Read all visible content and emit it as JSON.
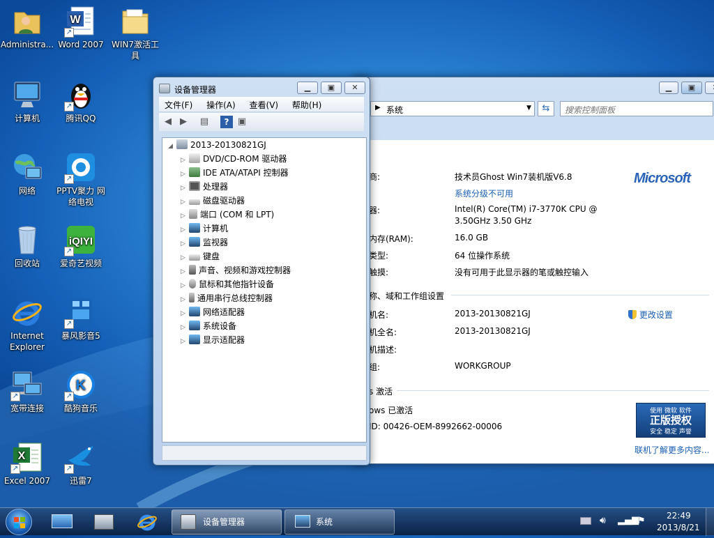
{
  "desktop": {
    "icons": [
      {
        "label": "Administra..."
      },
      {
        "label": "Word 2007"
      },
      {
        "label": "WIN7激活工具"
      },
      {
        "label": "计算机"
      },
      {
        "label": "腾讯QQ"
      },
      {
        "label": "网络"
      },
      {
        "label": "PPTV聚力 网络电视"
      },
      {
        "label": "回收站"
      },
      {
        "label": "爱奇艺视频"
      },
      {
        "label": "Internet Explorer"
      },
      {
        "label": "暴风影音5"
      },
      {
        "label": "宽带连接"
      },
      {
        "label": "酷狗音乐"
      },
      {
        "label": "Excel 2007"
      },
      {
        "label": "迅雷7"
      }
    ]
  },
  "device_manager": {
    "title": "设备管理器",
    "menu": [
      "文件(F)",
      "操作(A)",
      "查看(V)",
      "帮助(H)"
    ],
    "root": "2013-20130821GJ",
    "nodes": [
      "DVD/CD-ROM 驱动器",
      "IDE ATA/ATAPI 控制器",
      "处理器",
      "磁盘驱动器",
      "端口 (COM 和 LPT)",
      "计算机",
      "监视器",
      "键盘",
      "声音、视频和游戏控制器",
      "鼠标和其他指针设备",
      "通用串行总线控制器",
      "网络适配器",
      "系统设备",
      "显示适配器"
    ]
  },
  "system_window": {
    "breadcrumb": "系统",
    "search_placeholder": "搜索控制面板",
    "brand": "Microsoft",
    "rows": {
      "manufacturer_label": "商:",
      "manufacturer_value": "技术员Ghost Win7装机版V6.8",
      "rating_link": "系统分级不可用",
      "cpu_label": "器:",
      "cpu_value_1": "Intel(R) Core(TM) i7-3770K CPU @",
      "cpu_value_2": "3.50GHz   3.50 GHz",
      "ram_label": "内存(RAM):",
      "ram_value": "16.0 GB",
      "type_label": "类型:",
      "type_value": "64 位操作系统",
      "pen_label": "触摸:",
      "pen_value": "没有可用于此显示器的笔或触控输入",
      "section_name": "称、域和工作组设置",
      "computer_name_label": "机名:",
      "computer_name_value": "2013-20130821GJ",
      "change_settings": "更改设置",
      "full_name_label": "机全名:",
      "full_name_value": "2013-20130821GJ",
      "desc_label": "机描述:",
      "workgroup_label": "组:",
      "workgroup_value": "WORKGROUP",
      "section_activation": "s 激活",
      "activated": "ows 已激活",
      "product_id": "ID: 00426-OEM-8992662-00006",
      "genuine_line1": "使用 微软 软件",
      "genuine_line2": "正版授权",
      "genuine_line3": "安全 稳定 声誉",
      "learn_more": "联机了解更多内容..."
    }
  },
  "taskbar": {
    "items": [
      "设备管理器",
      "系统"
    ],
    "time": "22:49",
    "date": "2013/8/21"
  }
}
